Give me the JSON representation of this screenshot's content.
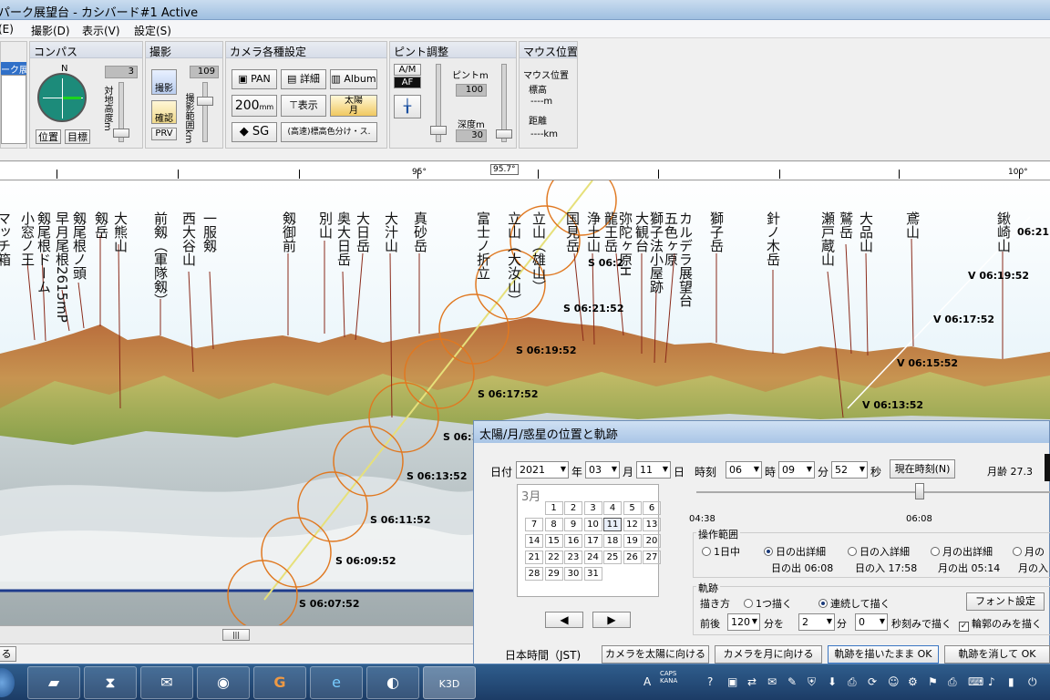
{
  "window": {
    "title": "パーク展望台 - カシバード#1 Active"
  },
  "menu": [
    "(E)",
    "撮影(D)",
    "表示(V)",
    "設定(S)"
  ],
  "panels": {
    "list": {
      "selected_item": "ーク展"
    },
    "compass": {
      "title": "コンパス",
      "north": "N",
      "height_label": "対地高度m",
      "height_value": "3",
      "btn_pos": "位置",
      "btn_target": "目標"
    },
    "shoot": {
      "title": "撮影",
      "btn_shoot": "撮影",
      "btn_confirm": "確認",
      "btn_prv": "PRV",
      "range_label": "撮影範囲km",
      "range_value": "109"
    },
    "camera": {
      "title": "カメラ各種設定",
      "btn_pan": "PAN",
      "btn_detail": "詳細",
      "btn_album": "Album",
      "btn_200": "200",
      "btn_200_unit": "mm",
      "btn_show": "表示",
      "btn_sun": "太陽",
      "btn_moon": "月",
      "btn_sg": "SG",
      "btn_color": "(高速)標高色分け・ス."
    },
    "focus": {
      "title": "ピント調整",
      "btn_am": "A/M",
      "btn_af": "AF",
      "pinto_label": "ピントm",
      "pinto_value": "100",
      "depth_label": "深度m",
      "depth_value": "30"
    },
    "mouse": {
      "title": "マウス位置",
      "pos_label": "マウス位置",
      "alt_label": "標高",
      "alt_value": "----m",
      "dist_label": "距離",
      "dist_value": "----km"
    }
  },
  "ruler": {
    "labels": [
      "95°",
      "95.7°",
      "100°"
    ]
  },
  "peaks": [
    "マッチ箱",
    "小窓ノ王",
    "剱尾根ドーム",
    "早月尾根2615mP",
    "剱尾根ノ頭",
    "剱岳",
    "大熊山",
    "前剱（軍隊剱）",
    "西大谷山",
    "一服剱",
    "剱御前",
    "別山",
    "奥大日岳",
    "大日岳",
    "大汁山",
    "真砂岳",
    "富士ノ折立",
    "立山（大汝山）",
    "立山（雄山）",
    "国見岳",
    "浄土山",
    "龍王岳",
    "弥陀ヶ原H",
    "大観台",
    "獅子法小屋跡",
    "五色ヶ原",
    "カルデラ展望台",
    "獅子岳",
    "針ノ木岳",
    "瀬戸蔵山",
    "鷲岳",
    "大品山",
    "鳶山",
    "鍬崎山"
  ],
  "track": {
    "sun": [
      "S 06:21:52",
      "S 06:19:52",
      "S 06:17:52",
      "S 06:15:52",
      "S 06:13:52",
      "S 06:11:52",
      "S 06:09:52",
      "S 06:07:52",
      "S 06:2",
      "S 06"
    ],
    "moon": [
      "V 06:19:52",
      "V 06:17:52",
      "V 06:15:52",
      "V 06:13:52",
      "06:21"
    ]
  },
  "bottom": {
    "close_btn": "る"
  },
  "dialog": {
    "title": "太陽/月/惑星の位置と軌跡",
    "date_label": "日付",
    "year": "2021",
    "year_unit": "年",
    "month": "03",
    "month_unit": "月",
    "day": "11",
    "day_unit": "日",
    "time_label": "時刻",
    "hour": "06",
    "hour_unit": "時",
    "minute": "09",
    "minute_unit": "分",
    "second": "52",
    "second_unit": "秒",
    "now_btn": "現在時刻(N)",
    "moon_age": "月齢 27.3",
    "cal_month": "3月",
    "cal_days": [
      "1",
      "2",
      "3",
      "4",
      "5",
      "6",
      "7",
      "8",
      "9",
      "10",
      "11",
      "12",
      "13",
      "14",
      "15",
      "16",
      "17",
      "18",
      "19",
      "20",
      "21",
      "22",
      "23",
      "24",
      "25",
      "26",
      "27",
      "28",
      "29",
      "30",
      "31"
    ],
    "slider_start": "04:38",
    "slider_now": "06:08",
    "range_title": "操作範囲",
    "range_opts": [
      "1日中",
      "日の出詳細",
      "日の入詳細",
      "月の出詳細",
      "月の"
    ],
    "sunrise": "日の出 06:08",
    "sunset": "日の入 17:58",
    "moonrise": "月の出 05:14",
    "moonset": "月の入",
    "track_title": "軌跡",
    "draw_label": "描き方",
    "draw_opts": [
      "1つ描く",
      "連続して描く"
    ],
    "font_btn": "フォント設定",
    "range_before": "前後",
    "range_val": "120",
    "range_unit": "分を",
    "step_val": "2",
    "step_unit": "分",
    "sec_val": "0",
    "sec_unit": "秒刻みで描く",
    "outline_only": "輪郭のみを描く",
    "tz": "日本時間（JST)",
    "btn_sun": "カメラを太陽に向ける",
    "btn_moon": "カメラを月に向ける",
    "btn_keep": "軌跡を描いたまま OK",
    "btn_clear": "軌跡を消して OK"
  },
  "taskbar": {
    "tray_caps": "CAPS",
    "tray_kana": "KANA",
    "k3d": "K3D"
  }
}
